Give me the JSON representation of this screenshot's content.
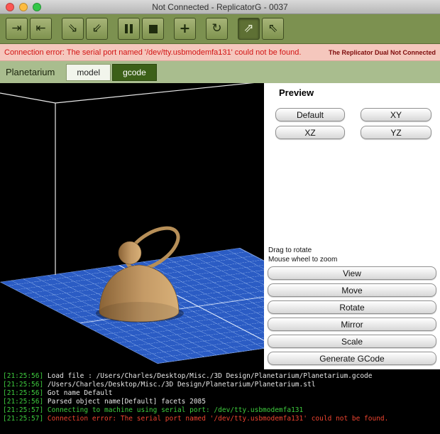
{
  "window": {
    "title": "Not Connected - ReplicatorG - 0037"
  },
  "toolbar": {
    "buttons": [
      {
        "name": "connect",
        "glyph": "⇥",
        "pressed": false
      },
      {
        "name": "disconnect",
        "glyph": "⇤",
        "pressed": false
      },
      {
        "name": "build",
        "glyph": "⇘",
        "pressed": false
      },
      {
        "name": "build-to-file",
        "glyph": "⇙",
        "pressed": false
      },
      {
        "name": "pause",
        "glyph": "",
        "pressed": false
      },
      {
        "name": "stop",
        "glyph": "",
        "pressed": false
      },
      {
        "name": "move-tool",
        "glyph": "+",
        "pressed": false
      },
      {
        "name": "rotate-tool",
        "glyph": "↻",
        "pressed": false
      },
      {
        "name": "axis-rotate-tool",
        "glyph": "⇗",
        "pressed": true
      },
      {
        "name": "axis-scale-tool",
        "glyph": "⇖",
        "pressed": false
      }
    ]
  },
  "error_banner": {
    "message": "Connection error: The serial port named '/dev/tty.usbmodemfa131' could not be found.",
    "machine_status": "The Replicator Dual Not Connected",
    "background_color": "#f5c7bd",
    "message_color": "#d21414"
  },
  "tabs": {
    "project": "Planetarium",
    "items": [
      {
        "label": "model",
        "selected": true
      },
      {
        "label": "gcode",
        "selected": false
      }
    ]
  },
  "preview": {
    "title": "Preview",
    "view_buttons": [
      "Default",
      "XY",
      "XZ",
      "YZ"
    ],
    "hint_drag": "Drag to rotate",
    "hint_zoom": "Mouse wheel to zoom",
    "action_buttons": [
      "View",
      "Move",
      "Rotate",
      "Mirror",
      "Scale",
      "Generate GCode"
    ]
  },
  "viewport": {
    "grid_color": "#2b5cc4",
    "model_color": "#c49a66"
  },
  "console": {
    "lines": [
      {
        "time": "[21:25:56]",
        "text": " Load file : /Users/Charles/Desktop/Misc./3D Design/Planetarium/Planetarium.gcode",
        "color": "#e8e8e8"
      },
      {
        "time": "[21:25:56]",
        "text": " /Users/Charles/Desktop/Misc./3D Design/Planetarium/Planetarium.stl",
        "color": "#e8e8e8"
      },
      {
        "time": "[21:25:56]",
        "text": " Got name Default",
        "color": "#e8e8e8"
      },
      {
        "time": "[21:25:56]",
        "text": " Parsed object name[Default] facets 2085",
        "color": "#e8e8e8"
      },
      {
        "time": "[21:25:57]",
        "text": " Connecting to machine using serial port: /dev/tty.usbmodemfa131",
        "color": "#3ecc3e"
      },
      {
        "time": "[21:25:57]",
        "text": " Connection error: The serial port named '/dev/tty.usbmodemfa131' could not be found.",
        "color": "#ef4430"
      }
    ]
  }
}
